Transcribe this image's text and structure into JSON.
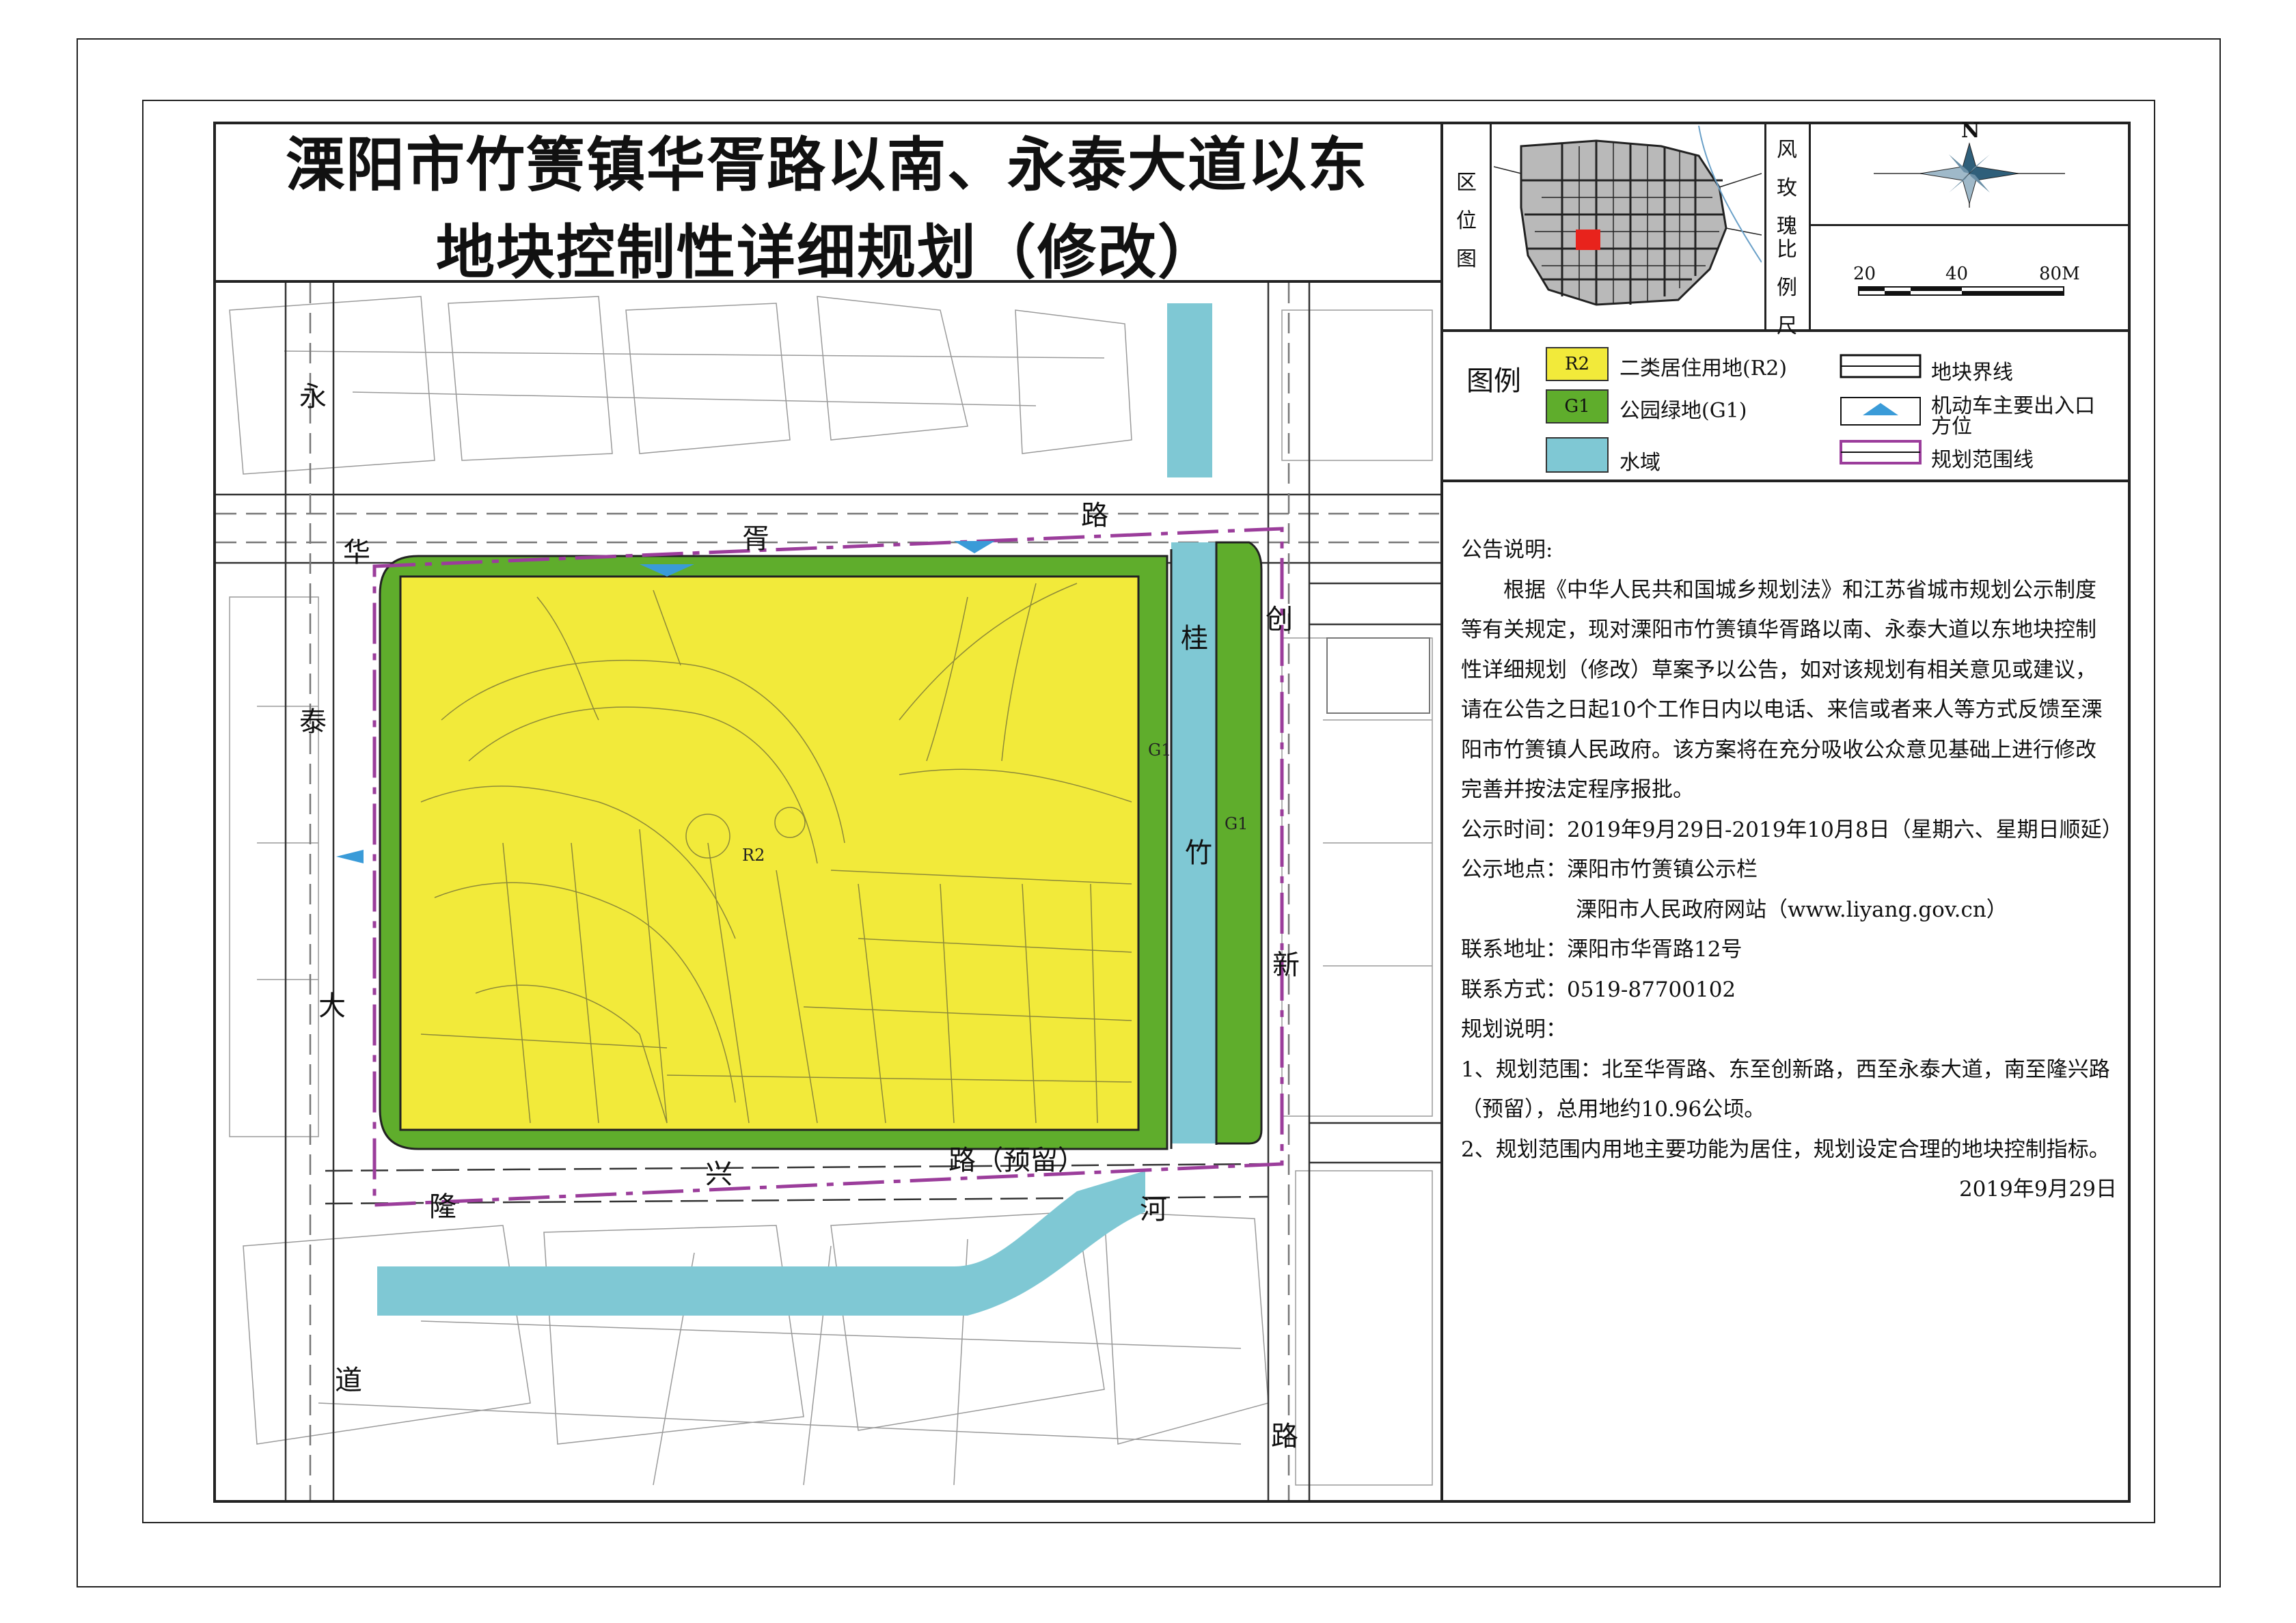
{
  "title": {
    "line1": "溧阳市竹箦镇华胥路以南、永泰大道以东",
    "line2": "地块控制性详细规划（修改）"
  },
  "sidebar": {
    "location_label": [
      "区",
      "位",
      "图"
    ],
    "wind_label": [
      "风",
      "玫",
      "瑰"
    ],
    "scale_label": [
      "比",
      "例",
      "尺"
    ],
    "compass_letter": "N",
    "scale_ticks": [
      "20",
      "40",
      "80M"
    ]
  },
  "legend": {
    "heading": "图例",
    "items": [
      {
        "code": "R2",
        "label": "二类居住用地(R2)",
        "color": "#f2ea3a"
      },
      {
        "code": "G1",
        "label": "公园绿地(G1)",
        "color": "#5fad2c"
      },
      {
        "code": "",
        "label": "水域",
        "color": "#7fc8d4"
      },
      {
        "code": "",
        "label": "地块界线",
        "color": "#222222"
      },
      {
        "code": "",
        "label": "机动车主要出入口方位",
        "color": "#3a9bd8"
      },
      {
        "code": "",
        "label": "规划范围线",
        "color": "#9b3d9b"
      }
    ]
  },
  "map": {
    "parcel_codes": {
      "r2": "R2",
      "g1_a": "G1",
      "g1_b": "G1"
    },
    "roads": {
      "north": [
        "华",
        "胥",
        "路"
      ],
      "west": [
        "永",
        "泰",
        "大",
        "道"
      ],
      "east": [
        "创",
        "新",
        "路"
      ],
      "south": [
        "隆",
        "兴",
        "路（预留）"
      ],
      "canal_east": [
        "桂",
        "竹"
      ],
      "canal_south": "河"
    }
  },
  "notice": {
    "heading": "公告说明:",
    "body": "根据《中华人民共和国城乡规划法》和江苏省城市规划公示制度等有关规定，现对溧阳市竹箦镇华胥路以南、永泰大道以东地块控制性详细规划（修改）草案予以公告，如对该规划有相关意见或建议，请在公告之日起10个工作日内以电话、来信或者来人等方式反馈至溧阳市竹箦镇人民政府。该方案将在充分吸收公众意见基础上进行修改完善并按法定程序报批。",
    "time": "公示时间：2019年9月29日-2019年10月8日（星期六、星期日顺延）",
    "place1": "公示地点：溧阳市竹箦镇公示栏",
    "place2": "溧阳市人民政府网站（www.liyang.gov.cn）",
    "address": "联系地址：溧阳市华胥路12号",
    "phone": "联系方式：0519-87700102",
    "plan_heading": "规划说明：",
    "plan1": "1、规划范围：北至华胥路、东至创新路，西至永泰大道，南至隆兴路（预留），总用地约10.96公顷。",
    "plan2": "2、规划范围内用地主要功能为居住，规划设定合理的地块控制指标。",
    "date": "2019年9月29日"
  }
}
